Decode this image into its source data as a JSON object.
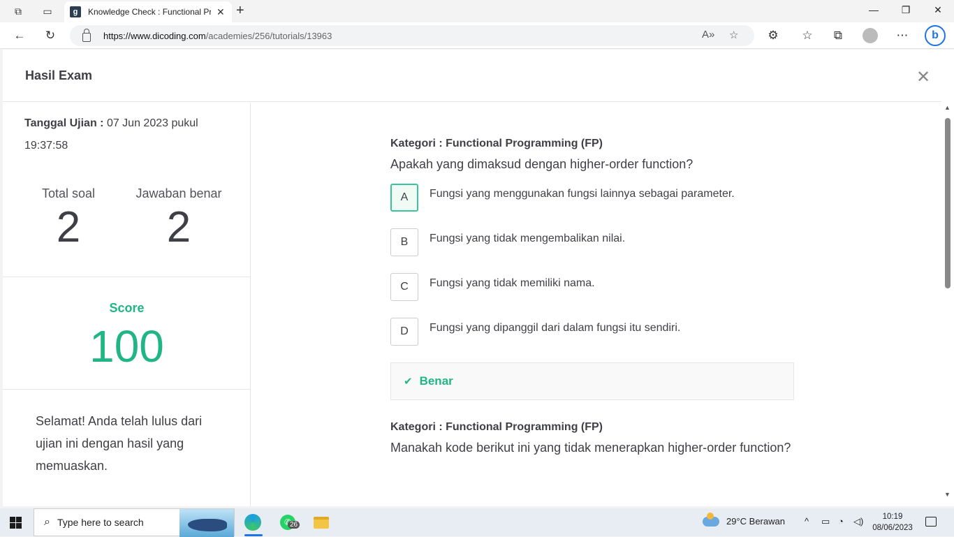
{
  "browser": {
    "tab_title": "Knowledge Check : Functional Pr",
    "tab_favicon": "g",
    "url_domain": "https://www.dicoding.com",
    "url_path": "/academies/256/tutorials/13963",
    "profile": "profile-avatar"
  },
  "page": {
    "header_title": "Hasil Exam",
    "sidebar": {
      "date_label": "Tanggal Ujian :",
      "date_value": "07 Jun 2023 pukul 19:37:58",
      "total_label": "Total soal",
      "total_value": "2",
      "correct_label": "Jawaban benar",
      "correct_value": "2",
      "score_label": "Score",
      "score_value": "100",
      "message": "Selamat! Anda telah lulus dari ujian ini dengan hasil yang memuaskan."
    },
    "questions": [
      {
        "category": "Kategori : Functional Programming (FP)",
        "text": "Apakah yang dimaksud dengan higher-order function?",
        "options": [
          {
            "letter": "A",
            "text": "Fungsi yang menggunakan fungsi lainnya sebagai parameter.",
            "selected": true
          },
          {
            "letter": "B",
            "text": "Fungsi yang tidak mengembalikan nilai.",
            "selected": false
          },
          {
            "letter": "C",
            "text": "Fungsi yang tidak memiliki nama.",
            "selected": false
          },
          {
            "letter": "D",
            "text": "Fungsi yang dipanggil dari dalam fungsi itu sendiri.",
            "selected": false
          }
        ],
        "result": "Benar"
      },
      {
        "category": "Kategori : Functional Programming (FP)",
        "text": "Manakah kode berikut ini yang tidak menerapkan higher-order function?"
      }
    ]
  },
  "taskbar": {
    "search_placeholder": "Type here to search",
    "whatsapp_badge": "26",
    "weather": "29°C  Berawan",
    "time": "10:19",
    "date": "08/06/2023"
  },
  "colors": {
    "accent_green": "#1fb584",
    "text_dark": "#3f3f46"
  }
}
